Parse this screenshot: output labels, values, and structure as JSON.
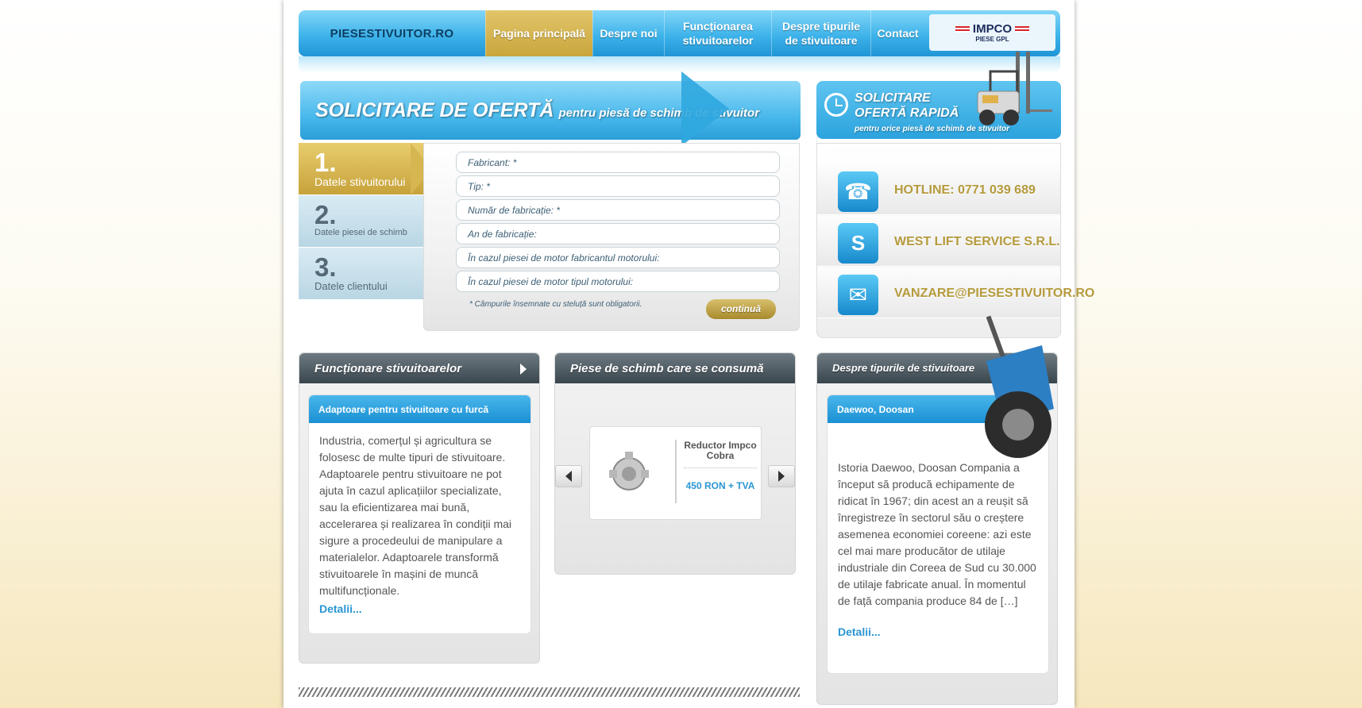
{
  "nav": {
    "logo": "PIESESTIVUITOR.RO",
    "items": [
      {
        "label": "Pagina principală"
      },
      {
        "label": "Despre noi"
      },
      {
        "label": "Funcționarea stivuitoarelor"
      },
      {
        "label": "Despre tipurile de stivuitoare"
      },
      {
        "label": "Contact"
      }
    ],
    "brand_name": "IMPCO",
    "brand_sub": "PIESE GPL"
  },
  "banner": {
    "title_big": "SOLICITARE DE OFERTĂ",
    "title_small": "pentru piesă de schimb de stivuitor"
  },
  "steps": [
    {
      "num": "1.",
      "label": "Datele stivuitorului"
    },
    {
      "num": "2.",
      "label": "Datele piesei de schimb"
    },
    {
      "num": "3.",
      "label": "Datele clientului"
    }
  ],
  "form": {
    "fields": [
      {
        "placeholder": "Fabricant: *"
      },
      {
        "placeholder": "Tip: *"
      },
      {
        "placeholder": "Număr de fabricație: *"
      },
      {
        "placeholder": "An de fabricație:"
      },
      {
        "placeholder": "În cazul piesei de motor fabricantul motorului:"
      },
      {
        "placeholder": "În cazul piesei de motor tipul motorului:"
      }
    ],
    "note": "* Câmpurile însemnate cu steluță sunt obligatorii.",
    "continue_label": "continuă"
  },
  "quick_offer": {
    "line1": "SOLICITARE",
    "line2": "OFERTĂ RAPIDĂ",
    "sub": "pentru orice piesă de schimb de stivuitor"
  },
  "contacts": [
    {
      "icon": "phone-icon",
      "text": "HOTLINE: 0771 039 689"
    },
    {
      "icon": "skype-icon",
      "text": "WEST LIFT SERVICE S.R.L."
    },
    {
      "icon": "mail-icon",
      "text": "VANZARE@PIESESTIVUITOR.RO"
    }
  ],
  "panel1": {
    "title": "Funcționare stivuitoarelor",
    "card_title": "Adaptoare pentru stivuitoare cu furcă",
    "text": "Industria, comerțul și agricultura se folosesc de multe tipuri de stivuitoare. Adaptoarele pentru stivuitoare ne pot ajuta în cazul aplicațiilor specializate, sau la eficientizarea mai bună, accelerarea și realizarea în condiții mai sigure a procedeului de manipulare a materialelor. Adaptoarele transformă stivuitoarele în mașini de muncă multifuncționale.",
    "details": "Detalii..."
  },
  "panel2": {
    "title": "Piese de schimb care se consumă",
    "product_name": "Reductor Impco Cobra",
    "product_price": "450 RON + TVA"
  },
  "panel3": {
    "title": "Despre tipurile de stivuitoare",
    "card_title": "Daewoo, Doosan",
    "text": "Istoria Daewoo, Doosan Compania a început să producă echipamente de ridicat în 1967; din acest an a reușit să înregistreze în sectorul său o creștere asemenea economiei coreene: azi este cel mai mare producător de utilaje industriale din Coreea de Sud cu 30.000 de utilaje fabricate anual. În momentul de față compania produce 84 de […]",
    "details": "Detalii..."
  }
}
